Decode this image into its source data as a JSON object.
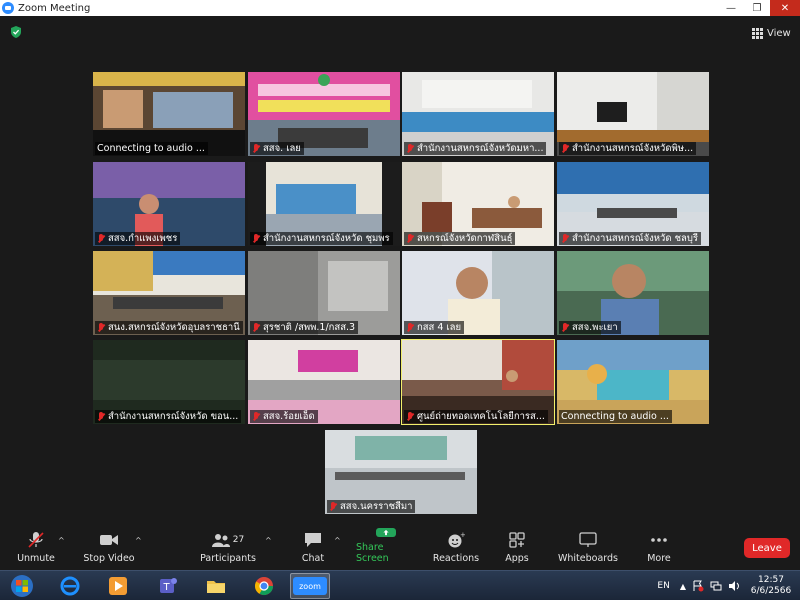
{
  "window": {
    "title": "Zoom Meeting",
    "minimize_glyph": "—",
    "maximize_glyph": "❐",
    "close_glyph": "✕"
  },
  "header": {
    "view_label": "View"
  },
  "tiles": [
    {
      "name": "Connecting to audio ...",
      "muted": false
    },
    {
      "name": "สสจ. เลย",
      "muted": true
    },
    {
      "name": "สำนักงานสหกรณ์จังหวัดมหา...",
      "muted": true
    },
    {
      "name": "สำนักงานสหกรณ์จังหวัดพิษ...",
      "muted": true
    },
    {
      "name": "สสจ.กำแพงเพชร",
      "muted": true
    },
    {
      "name": "สำนักงานสหกรณ์จังหวัด ชุมพร",
      "muted": true
    },
    {
      "name": "สหกรณ์จังหวัดกาฬสินธุ์",
      "muted": true
    },
    {
      "name": "สำนักงานสหกรณ์จังหวัด ชลบุรี",
      "muted": true
    },
    {
      "name": "สนง.สหกรณ์จังหวัดอุบลราชธานี",
      "muted": true
    },
    {
      "name": "สุรชาติ /สพพ.1/กสส.3",
      "muted": true
    },
    {
      "name": "กสส 4 เลย",
      "muted": true
    },
    {
      "name": "สสจ.พะเยา",
      "muted": true
    },
    {
      "name": "สำนักงานสหกรณ์จังหวัด ขอน...",
      "muted": true
    },
    {
      "name": "สสจ.ร้อยเอ็ด",
      "muted": true
    },
    {
      "name": "ศูนย์ถ่ายทอดเทคโนโลยีการส...",
      "muted": true,
      "active": true
    },
    {
      "name": "Connecting to audio ...",
      "muted": false
    },
    {
      "name": "สสจ.นครราชสีมา",
      "muted": true
    }
  ],
  "toolbar": {
    "unmute": "Unmute",
    "stop_video": "Stop Video",
    "participants": "Participants",
    "participants_count": "27",
    "chat": "Chat",
    "share_screen": "Share Screen",
    "reactions": "Reactions",
    "apps": "Apps",
    "whiteboards": "Whiteboards",
    "more": "More",
    "leave": "Leave",
    "accent": "#e02828",
    "share_color": "#23a55a"
  },
  "taskbar": {
    "language": "EN",
    "time": "12:57",
    "date": "6/6/2566",
    "zoom_label": "zoom",
    "icons": [
      "windows-start-icon",
      "internet-explorer-icon",
      "media-player-icon",
      "teams-icon",
      "file-explorer-icon",
      "chrome-icon",
      "zoom-icon"
    ]
  }
}
